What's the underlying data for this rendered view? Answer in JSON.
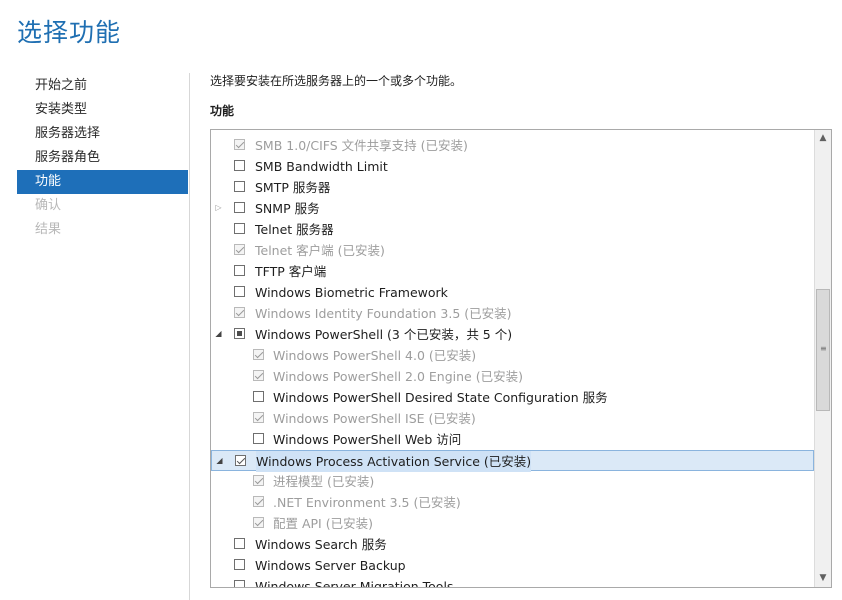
{
  "page": {
    "title": "选择功能"
  },
  "nav": {
    "items": [
      {
        "label": "开始之前",
        "state": "normal"
      },
      {
        "label": "安装类型",
        "state": "normal"
      },
      {
        "label": "服务器选择",
        "state": "normal"
      },
      {
        "label": "服务器角色",
        "state": "normal"
      },
      {
        "label": "功能",
        "state": "active"
      },
      {
        "label": "确认",
        "state": "disabled"
      },
      {
        "label": "结果",
        "state": "disabled"
      }
    ]
  },
  "main": {
    "description": "选择要安装在所选服务器上的一个或多个功能。",
    "section_label": "功能",
    "features": [
      {
        "label": "SMB 1.0/CIFS 文件共享支持 (已安装)",
        "level": 0,
        "check": "checked",
        "disabled": true,
        "expander": ""
      },
      {
        "label": "SMB Bandwidth Limit",
        "level": 0,
        "check": "unchecked",
        "disabled": false,
        "expander": ""
      },
      {
        "label": "SMTP 服务器",
        "level": 0,
        "check": "unchecked",
        "disabled": false,
        "expander": ""
      },
      {
        "label": "SNMP 服务",
        "level": 0,
        "check": "unchecked",
        "disabled": false,
        "expander": "collapsed"
      },
      {
        "label": "Telnet 服务器",
        "level": 0,
        "check": "unchecked",
        "disabled": false,
        "expander": ""
      },
      {
        "label": "Telnet 客户端 (已安装)",
        "level": 0,
        "check": "checked",
        "disabled": true,
        "expander": ""
      },
      {
        "label": "TFTP 客户端",
        "level": 0,
        "check": "unchecked",
        "disabled": false,
        "expander": ""
      },
      {
        "label": "Windows Biometric Framework",
        "level": 0,
        "check": "unchecked",
        "disabled": false,
        "expander": ""
      },
      {
        "label": "Windows Identity Foundation 3.5 (已安装)",
        "level": 0,
        "check": "checked",
        "disabled": true,
        "expander": ""
      },
      {
        "label": "Windows PowerShell (3 个已安装，共 5 个)",
        "level": 0,
        "check": "partial",
        "disabled": false,
        "expander": "expanded"
      },
      {
        "label": "Windows PowerShell 4.0 (已安装)",
        "level": 1,
        "check": "checked",
        "disabled": true,
        "expander": ""
      },
      {
        "label": "Windows PowerShell 2.0 Engine (已安装)",
        "level": 1,
        "check": "checked",
        "disabled": true,
        "expander": ""
      },
      {
        "label": "Windows PowerShell Desired State Configuration 服务",
        "level": 1,
        "check": "unchecked",
        "disabled": false,
        "expander": ""
      },
      {
        "label": "Windows PowerShell ISE (已安装)",
        "level": 1,
        "check": "checked",
        "disabled": true,
        "expander": ""
      },
      {
        "label": "Windows PowerShell Web 访问",
        "level": 1,
        "check": "unchecked",
        "disabled": false,
        "expander": ""
      },
      {
        "label": "Windows Process Activation Service (已安装)",
        "level": 0,
        "check": "checked",
        "disabled": false,
        "expander": "expanded",
        "selected": true
      },
      {
        "label": "进程模型 (已安装)",
        "level": 1,
        "check": "checked",
        "disabled": true,
        "expander": ""
      },
      {
        "label": ".NET Environment 3.5 (已安装)",
        "level": 1,
        "check": "checked",
        "disabled": true,
        "expander": ""
      },
      {
        "label": "配置 API (已安装)",
        "level": 1,
        "check": "checked",
        "disabled": true,
        "expander": ""
      },
      {
        "label": "Windows Search 服务",
        "level": 0,
        "check": "unchecked",
        "disabled": false,
        "expander": ""
      },
      {
        "label": "Windows Server Backup",
        "level": 0,
        "check": "unchecked",
        "disabled": false,
        "expander": ""
      },
      {
        "label": "Windows Server Migration Tools",
        "level": 0,
        "check": "unchecked",
        "disabled": false,
        "expander": ""
      }
    ]
  },
  "icons": {
    "expanded": "triangle-down-icon",
    "collapsed": "triangle-right-icon",
    "scroll_up": "chevron-up-icon",
    "scroll_down": "chevron-down-icon"
  },
  "colors": {
    "accent": "#1e6fb9",
    "title": "#1f6fb2",
    "selected_row": "#dbe9f7"
  }
}
